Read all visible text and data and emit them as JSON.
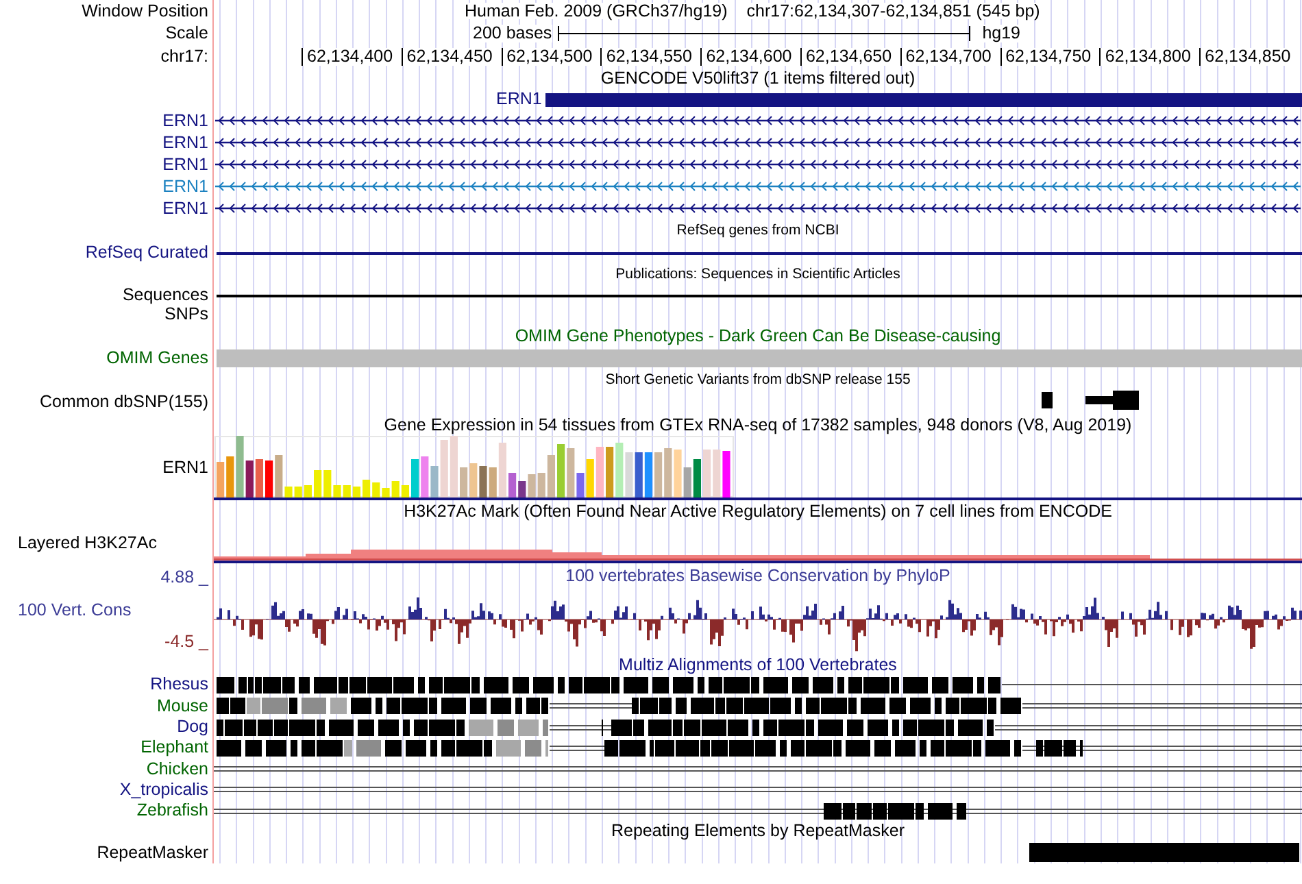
{
  "header": {
    "position_label": "Window Position",
    "assembly": "Human Feb. 2009 (GRCh37/hg19)",
    "position": "chr17:62,134,307-62,134,851 (545 bp)",
    "scale_label": "Scale",
    "scale_text": "200 bases",
    "scale_db": "hg19",
    "chrom_label": "chr17:",
    "ticks": [
      "62,134,400",
      "62,134,450",
      "62,134,500",
      "62,134,550",
      "62,134,600",
      "62,134,650",
      "62,134,700",
      "62,134,750",
      "62,134,800",
      "62,134,850"
    ]
  },
  "tracks": [
    {
      "kind": "genes",
      "title": "GENCODE V50lift37 (1 items filtered out)",
      "summary": {
        "name": "ERN1",
        "color": "#141482"
      },
      "items": [
        {
          "name": "ERN1",
          "color": "#141482"
        },
        {
          "name": "ERN1",
          "color": "#141482"
        },
        {
          "name": "ERN1",
          "color": "#141482"
        },
        {
          "name": "ERN1",
          "color": "#1b81c0"
        },
        {
          "name": "ERN1",
          "color": "#141482"
        }
      ]
    },
    {
      "kind": "refseq",
      "title": "RefSeq genes from NCBI",
      "label": "RefSeq Curated",
      "color": "#141482"
    },
    {
      "kind": "publications",
      "title": "Publications: Sequences in Scientific Articles",
      "label": "Sequences",
      "sublabel": "SNPs",
      "color": "#000000"
    },
    {
      "kind": "omim",
      "title": "OMIM Gene Phenotypes - Dark Green Can Be Disease-causing",
      "label": "OMIM Genes",
      "color": "#006400"
    },
    {
      "kind": "dbsnp",
      "title": "Short Genetic Variants from dbSNP release 155",
      "label": "Common dbSNP(155)",
      "color": "#000000"
    },
    {
      "kind": "gtex",
      "title": "Gene Expression in 54 tissues from GTEx RNA-seq of 17382 samples, 948 donors (V8, Aug 2019)",
      "label": "ERN1",
      "color": "#000000"
    },
    {
      "kind": "layered",
      "title": "H3K27Ac Mark (Often Found Near Active Regulatory Elements) on 7 cell lines from ENCODE",
      "label": "Layered H3K27Ac",
      "color": "#000000"
    },
    {
      "kind": "phylop",
      "title": "100 vertebrates Basewise Conservation by PhyloP",
      "label": "100 Vert. Cons",
      "max": "4.88 _",
      "min": "-4.5 _",
      "color": "#3c3c96"
    },
    {
      "kind": "multiz",
      "title": "Multiz Alignments of 100 Vertebrates",
      "color": "#141482",
      "species": [
        {
          "name": "Rhesus",
          "color": "#141482"
        },
        {
          "name": "Mouse",
          "color": "#006400"
        },
        {
          "name": "Dog",
          "color": "#141482"
        },
        {
          "name": "Elephant",
          "color": "#006400"
        },
        {
          "name": "Chicken",
          "color": "#006400"
        },
        {
          "name": "X_tropicalis",
          "color": "#141482"
        },
        {
          "name": "Zebrafish",
          "color": "#006400"
        }
      ]
    },
    {
      "kind": "repeatmasker",
      "title": "Repeating Elements by RepeatMasker",
      "label": "RepeatMasker",
      "color": "#000000"
    }
  ]
}
